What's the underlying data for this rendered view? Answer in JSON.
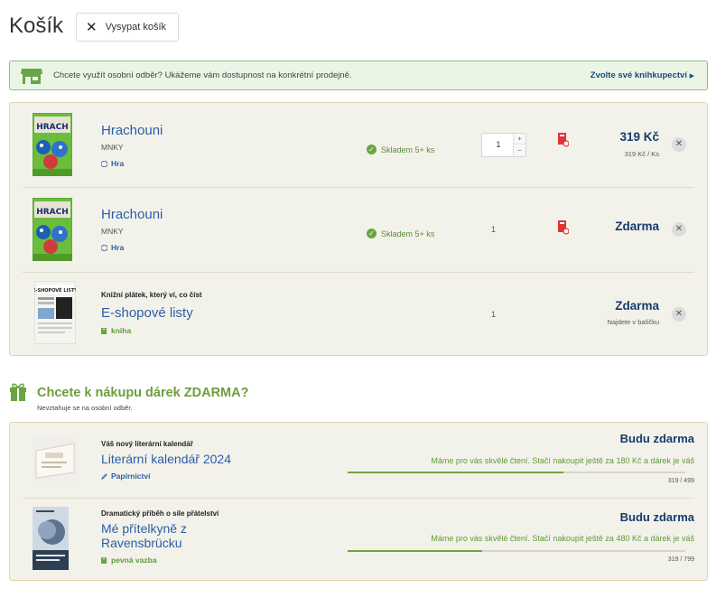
{
  "header": {
    "title": "Košík",
    "clear_cart_label": "Vysypat košík"
  },
  "pickup": {
    "text": "Chcete využít osobní odběr? Ukážeme vám dostupnost na konkrétní prodejně.",
    "link": "Zvolte své knihkupectví",
    "icon": "shop-icon"
  },
  "cart": {
    "items": [
      {
        "name": "Hrachouni",
        "brand": "MNKY",
        "type": "Hra",
        "stock": "Skladem 5+ ks",
        "quantity": "1",
        "price": "319 Kč",
        "unit_price": "319 Kč / Ks"
      },
      {
        "name": "Hrachouni",
        "brand": "MNKY",
        "type": "Hra",
        "stock": "Skladem 5+ ks",
        "quantity": "1",
        "price": "Zdarma"
      },
      {
        "category": "Knižní plátek, který ví, co číst",
        "name": "E-shopové listy",
        "type": "kniha",
        "quantity": "1",
        "price": "Zdarma",
        "note": "Najdete v balíčku"
      }
    ]
  },
  "gifts": {
    "heading": "Chcete k nákupu dárek ZDARMA?",
    "subheading": "Nevztahuje se na osobní odběr.",
    "items": [
      {
        "category": "Váš nový literární kalendář",
        "name": "Literární kalendář 2024",
        "type": "Papírnictví",
        "promo": "Budu zdarma",
        "message": "Máme pro vás skvělé čtení. Stačí nakoupit ještě za 180 Kč a dárek je váš",
        "progress_text": "319 / 499",
        "progress": 0.639
      },
      {
        "category": "Dramatický příběh o síle přátelství",
        "name_line1": "Mé přítelkyně z",
        "name_line2": "Ravensbrücku",
        "type": "pevná vazba",
        "promo": "Budu zdarma",
        "message": "Máme pro vás skvělé čtení. Stačí nakoupit ještě za 480 Kč a dárek je váš",
        "progress_text": "319 / 799",
        "progress": 0.399
      }
    ]
  },
  "colors": {
    "accent_green": "#6aa544",
    "link_blue": "#2a5ea8",
    "price_navy": "#173a6d",
    "box_bg": "#f3f2ea",
    "box_border": "#e1d5ad"
  }
}
